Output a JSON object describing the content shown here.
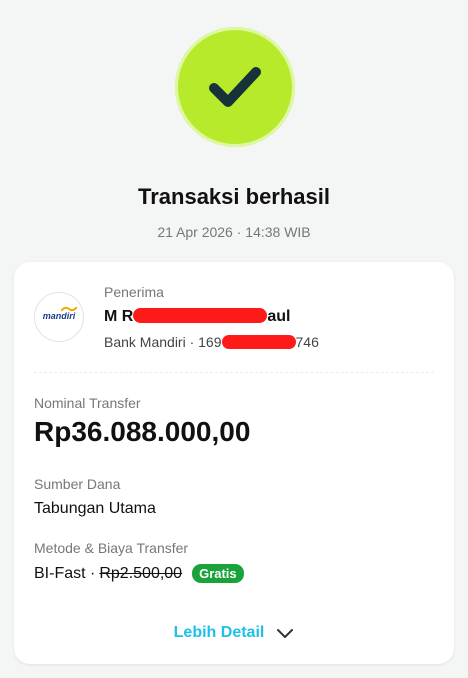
{
  "status": {
    "title": "Transaksi berhasil",
    "timestamp": "21 Apr 2026 · 14:38 WIB",
    "icon": "check-icon",
    "accent_color": "#b6ea2b"
  },
  "recipient": {
    "label": "Penerima",
    "name_prefix": "M R",
    "name_suffix": "aul",
    "bank": "Bank Mandiri · 169",
    "account_suffix": "746",
    "bank_logo_text": "mandiri"
  },
  "transfer": {
    "nominal_label": "Nominal Transfer",
    "nominal_value": "Rp36.088.000,00",
    "source_label": "Sumber Dana",
    "source_value": "Tabungan Utama",
    "method_label": "Metode & Biaya Transfer",
    "method_value": "BI-Fast ·",
    "fee_original": "Rp2.500,00",
    "fee_badge": "Gratis"
  },
  "actions": {
    "more_detail_label": "Lebih Detail"
  },
  "colors": {
    "badge_green": "#1aa33a",
    "link_cyan": "#1ec0e8",
    "redaction_red": "#ff1a1a"
  }
}
